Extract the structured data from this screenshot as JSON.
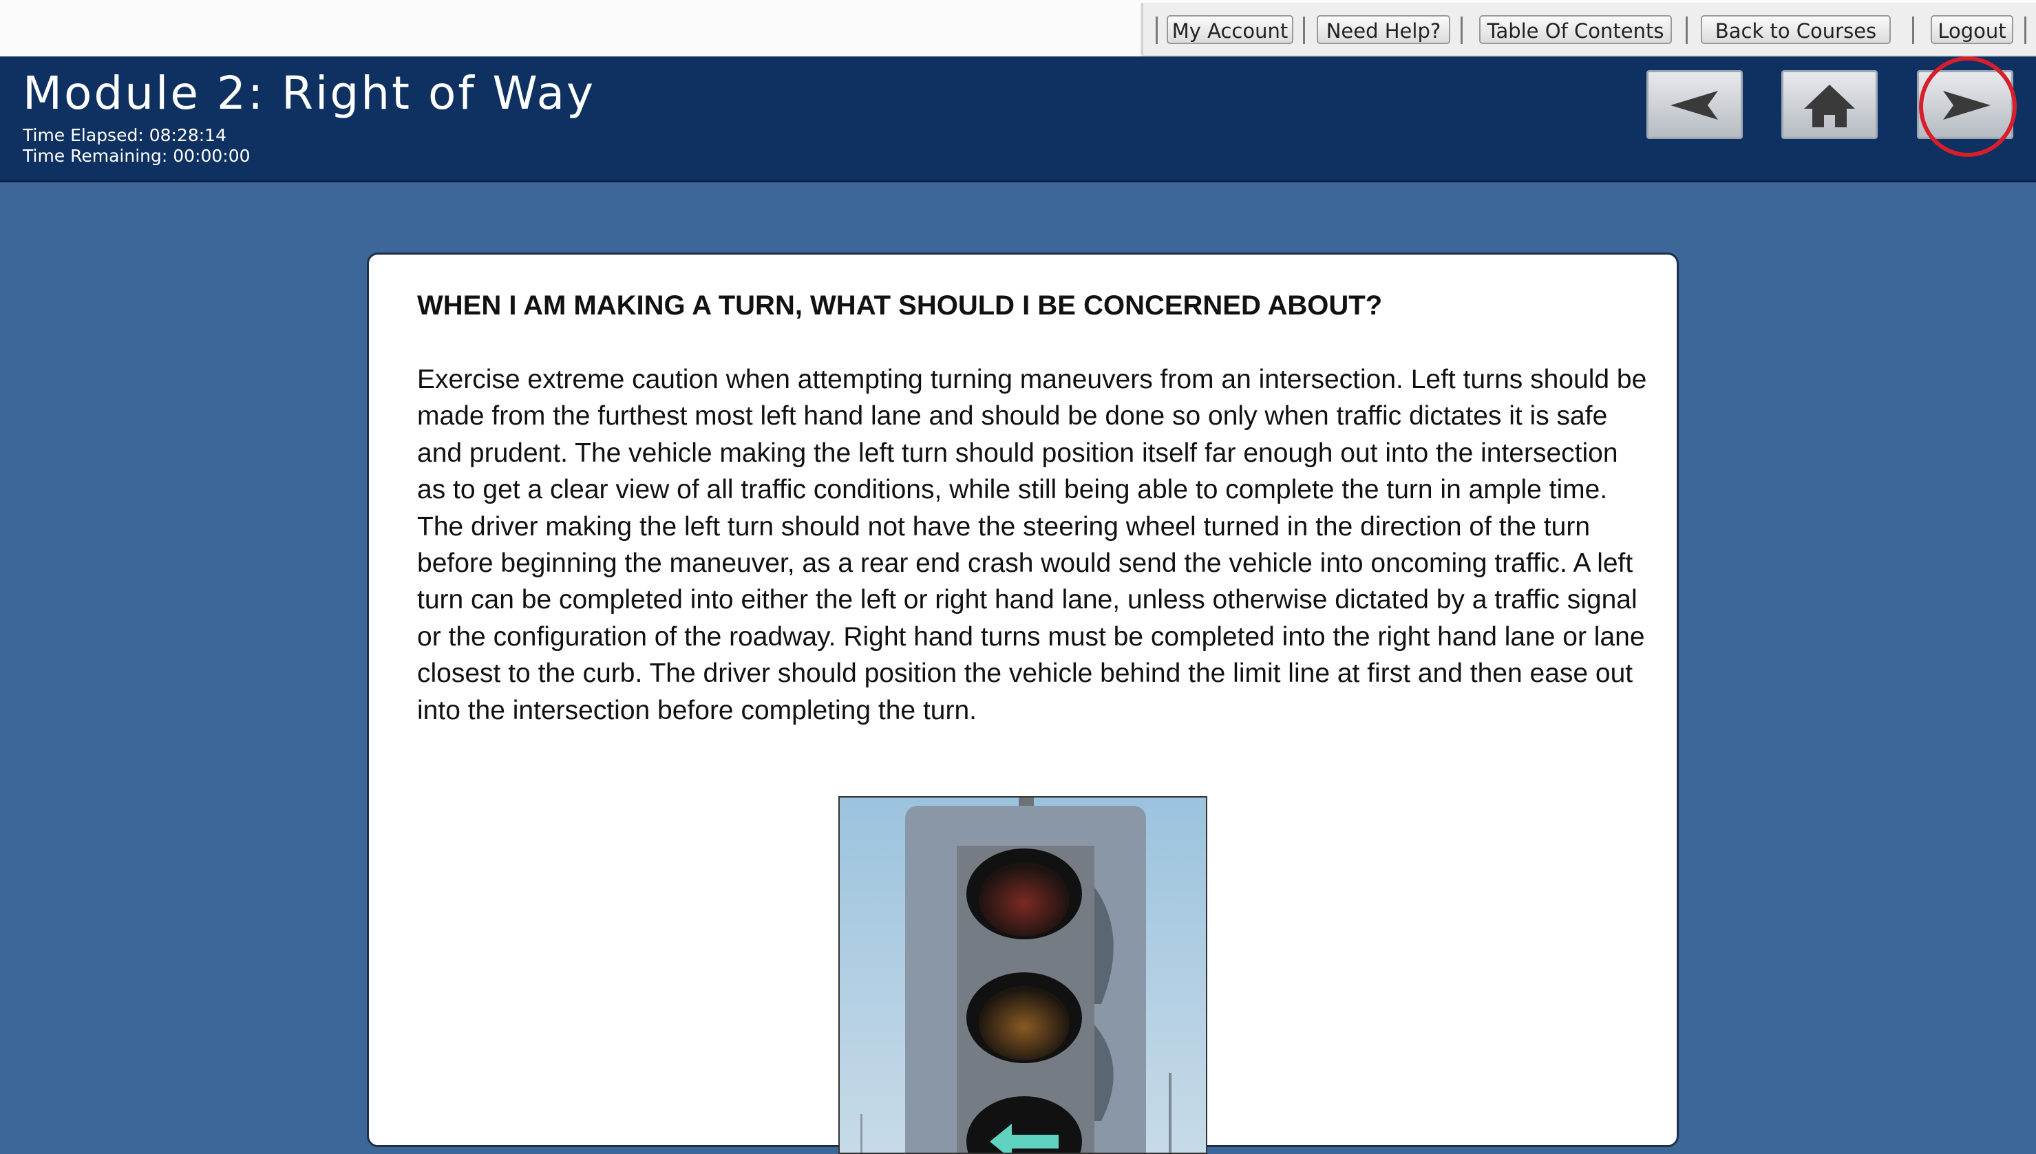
{
  "topbar": {
    "links": [
      {
        "label": "My Account"
      },
      {
        "label": "Need Help?"
      },
      {
        "label": "Table Of Contents"
      },
      {
        "label": "Back to Courses"
      },
      {
        "label": "Logout"
      }
    ]
  },
  "header": {
    "title": "Module 2: Right of Way",
    "time_elapsed": "Time Elapsed: 08:28:14",
    "time_remaining": "Time Remaining: 00:00:00",
    "nav": {
      "back_icon": "left-arrow-icon",
      "home_icon": "home-icon",
      "next_icon": "right-arrow-icon"
    }
  },
  "content": {
    "heading": "WHEN I AM MAKING A TURN, WHAT SHOULD I BE CONCERNED ABOUT?",
    "paragraph": "Exercise extreme caution when attempting turning maneuvers from an intersection. Left turns should be made from the furthest most left hand lane and should be done so only when traffic dictates it is safe and prudent. The vehicle making the left turn should position itself far enough out into the intersection as to get a clear view of all traffic conditions, while still being able to complete the turn in ample time. The driver making the left turn should not have the steering wheel turned in the direction of the turn before beginning the maneuver, as a rear end crash would send the vehicle into oncoming traffic. A left turn can be completed into either the left or right hand lane, unless otherwise dictated by a traffic signal or the configuration of the roadway. Right hand turns must be completed into the right hand lane or lane closest to the curb. The driver should position the vehicle behind the limit line at first and then ease out into the intersection before completing the turn.",
    "image": "traffic-signal-left-arrow-photo"
  },
  "colors": {
    "page_background": "#3e6799",
    "header_background": "#0f3161",
    "highlight": "#d81e2a"
  }
}
